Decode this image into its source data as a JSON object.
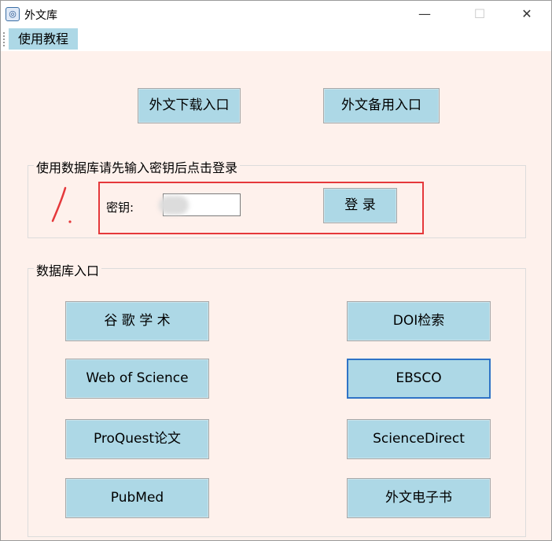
{
  "window": {
    "title": "外文库",
    "icon": "app-logo-icon"
  },
  "titlebar_controls": {
    "minimize": "—",
    "maximize": "☐",
    "close": "✕"
  },
  "menu": {
    "tutorial_label": "使用教程"
  },
  "top_buttons": {
    "download_entry": "外文下载入口",
    "backup_entry": "外文备用入口"
  },
  "login_group": {
    "title": "使用数据库请先输入密钥后点击登录",
    "key_label": "密钥:",
    "key_value": "",
    "login_button": "登 录"
  },
  "database_group": {
    "title": "数据库入口",
    "buttons": {
      "google_scholar": "谷 歌 学 术",
      "doi_search": "DOI检索",
      "web_of_science": "Web of Science",
      "ebsco": "EBSCO",
      "proquest": "ProQuest论文",
      "sciencedirect": "ScienceDirect",
      "pubmed": "PubMed",
      "ebooks": "外文电子书"
    }
  },
  "colors": {
    "window_bg": "#fef1ec",
    "button_bg": "#add8e6",
    "focus_border": "#2f73c6",
    "annotation_red": "#e5383b"
  }
}
